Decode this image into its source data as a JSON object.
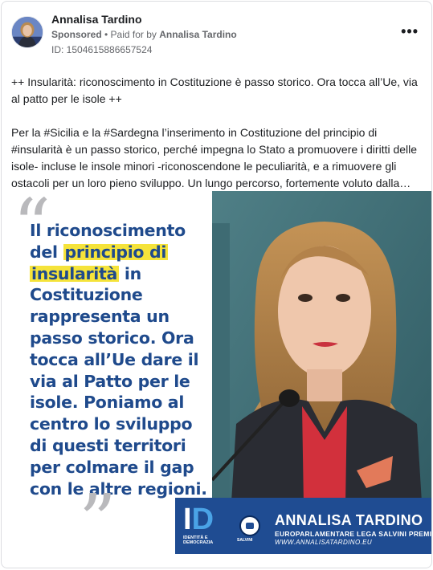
{
  "ad": {
    "page_name": "Annalisa Tardino",
    "sponsored_label": "Sponsored",
    "separator": " • ",
    "paid_for_prefix": "Paid for by ",
    "paid_for_name": "Annalisa Tardino",
    "ad_id": "ID: 1504615886657524",
    "more_label": "•••"
  },
  "body": {
    "paragraph_1": "++ Insularità: riconoscimento in Costituzione è passo storico. Ora tocca all’Ue, via al patto per le isole ++",
    "paragraph_2": "Per la #Sicilia e la #Sardegna l’inserimento in Costituzione del principio di #insularità è un passo storico, perché impegna lo Stato a promuovere i diritti delle isole- incluse le insole minori -riconoscendone le peculiarità, e a rimuovere gli ostacoli per un loro pieno sviluppo. Un lungo percorso, fortemente voluto dalla…"
  },
  "creative": {
    "quote_open": "“",
    "quote_close": "”",
    "quote_part_1": "Il riconoscimento del ",
    "quote_highlight_1": "principio di",
    "quote_part_2": " ",
    "quote_highlight_2": "insularità",
    "quote_part_3": " in Costituzione rappresenta un passo storico. Ora tocca all’Ue dare il via al Patto per le isole. Poniamo al centro lo sviluppo di questi territori per colmare il gap con le altre regioni.",
    "id_logo_letters_i": "I",
    "id_logo_letters_d": "D",
    "id_logo_caption": "IDENTITÀ E DEMOCRAZIA",
    "lega_caption": "SALVINI",
    "footer_name": "ANNALISA TARDINO",
    "footer_role": "EUROPARLAMENTARE LEGA SALVINI PREMIER",
    "footer_url": "WWW.ANNALISATARDINO.EU",
    "highlight_color": "#f5e33a",
    "quote_color": "#1f4a8c",
    "band_color": "#1f4c92"
  },
  "icons": {
    "more": "more-options-icon",
    "avatar": "profile-avatar"
  }
}
